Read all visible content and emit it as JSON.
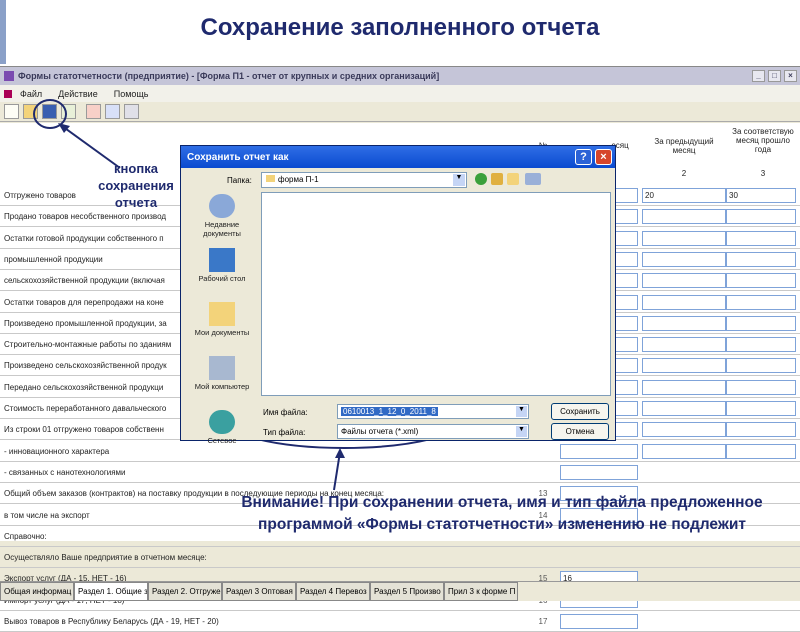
{
  "slide": {
    "title": "Сохранение заполненного отчета",
    "annotation_button": "кнопка сохранения отчета",
    "note": "Внимание! При сохранении отчета, имя и тип файла предложенное программой «Формы статотчетности» изменению не подлежит"
  },
  "app": {
    "title": "Формы статотчетности (предприятие) - [Форма П1 - отчет от крупных и средних организаций]",
    "menu": [
      "Файл",
      "Действие",
      "Помощь"
    ],
    "column_headers": {
      "no": "№",
      "month": "есяц",
      "prev_month": "За предыдущий месяц",
      "same_month_prev_year": "За соответствую месяц прошло года",
      "col2": "2",
      "col3": "3"
    },
    "rows": [
      {
        "label": "Отгружено товаров"
      },
      {
        "label": "Продано товаров несобственного производ"
      },
      {
        "label": "Остатки готовой продукции собственного п"
      },
      {
        "label": "промышленной продукции"
      },
      {
        "label": "сельскохозяйственной продукции (включая"
      },
      {
        "label": "Остатки товаров для перепродажи на коне"
      },
      {
        "label": "Произведено промышленной продукции, за"
      },
      {
        "label": "Строительно-монтажные работы по зданиям"
      },
      {
        "label": "Произведено сельскохозяйственной продук"
      },
      {
        "label": "Передано сельскохозяйственной продукци"
      },
      {
        "label": "Стоимость переработанного давальческого"
      },
      {
        "label": "Из строки 01 отгружено товаров собственн"
      },
      {
        "label": "- инновационного характера"
      },
      {
        "label": "- связанных с нанотехнологиями"
      },
      {
        "label": "Общий объем заказов (контрактов) на поставку продукции в последующие периоды на конец месяца:",
        "num": "13"
      },
      {
        "label": "в том числе на экспорт",
        "num": "14"
      },
      {
        "label": "Справочно:"
      },
      {
        "label": "Осуществляло Ваше предприятие в отчетном месяце:"
      },
      {
        "label": "Экспорт услуг (ДА - 15, НЕТ - 16)",
        "num": "15",
        "value": "16"
      },
      {
        "label": "Импорт услуг (ДА - 17, НЕТ - 18)",
        "num": "16"
      },
      {
        "label": "Вывоз товаров в Республику Беларусь (ДА - 19, НЕТ - 20)",
        "num": "17"
      }
    ],
    "row1_values": {
      "prev": "20",
      "prev_year": "30"
    },
    "tabs": [
      "Общая информац",
      "Раздел 1. Общие з",
      "Раздел 2. Отгружен",
      "Раздел 3 Оптовая",
      "Раздел 4 Перевоз",
      "Раздел 5 Произво",
      "Прил 3 к форме П"
    ]
  },
  "dialog": {
    "title": "Сохранить отчет как",
    "look_in_label": "Папка:",
    "look_in_value": "форма П-1",
    "places": [
      "Недавние документы",
      "Рабочий стол",
      "Мои документы",
      "Мой компьютер",
      "Сетевое"
    ],
    "filename_label": "Имя файла:",
    "filename_value": "0610013_1_12_0_2011_8",
    "filetype_label": "Тип файла:",
    "filetype_value": "Файлы отчета (*.xml)",
    "save_label": "Сохранить",
    "cancel_label": "Отмена"
  },
  "colors": {
    "accent": "#1f2a6e",
    "dialog_title": "#0a4ad0"
  }
}
